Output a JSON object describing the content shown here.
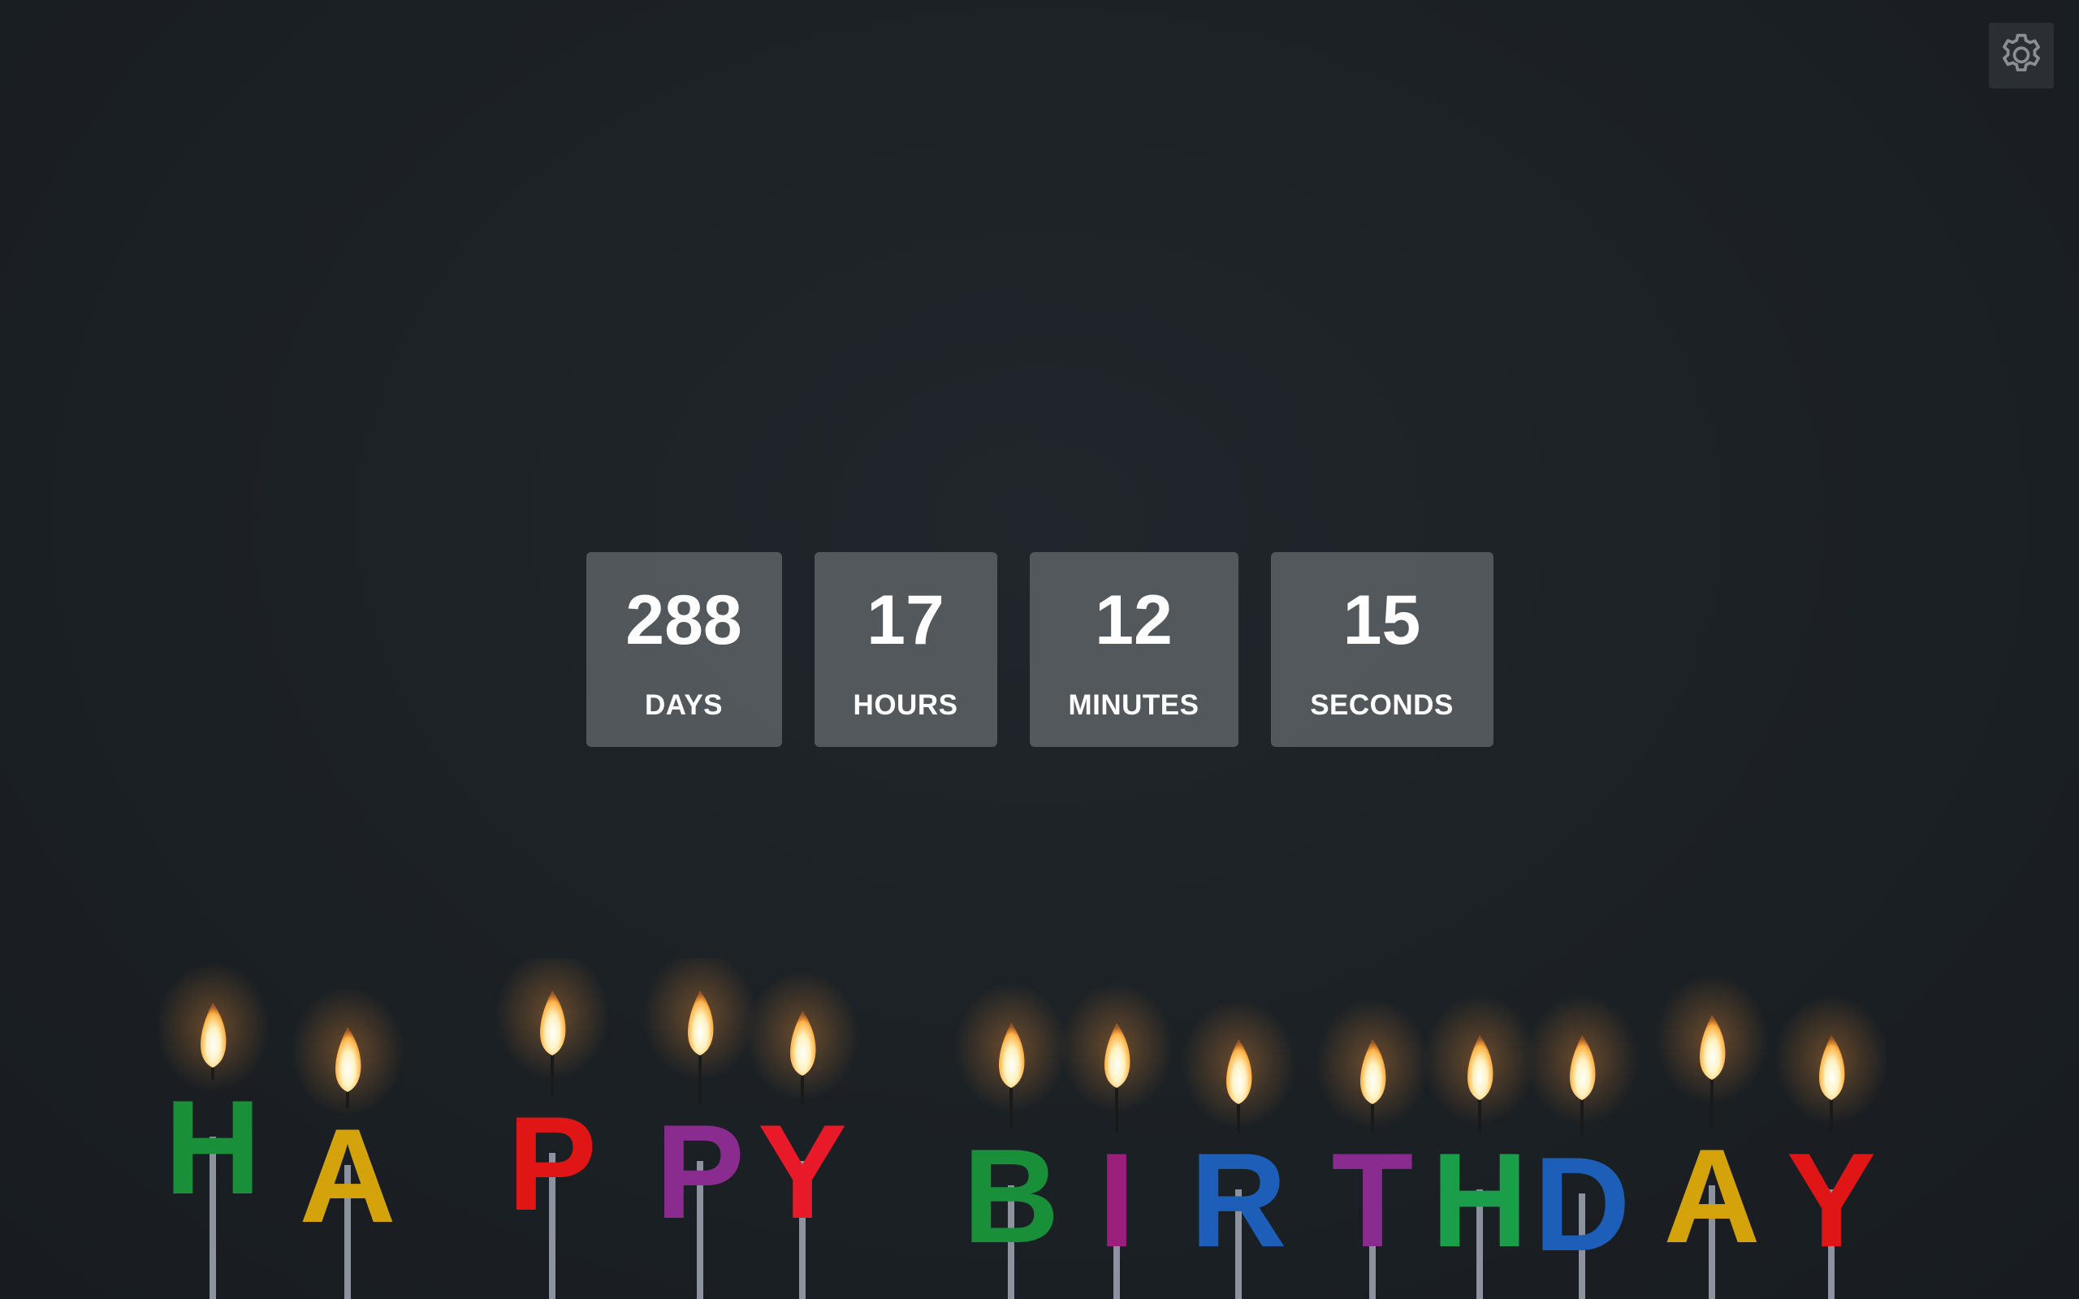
{
  "settings": {
    "icon": "gear-icon"
  },
  "countdown": {
    "days": {
      "value": "288",
      "label": "DAYS"
    },
    "hours": {
      "value": "17",
      "label": "HOURS"
    },
    "minutes": {
      "value": "12",
      "label": "MINUTES"
    },
    "seconds": {
      "value": "15",
      "label": "SECONDS"
    }
  },
  "background": {
    "letters": [
      "H",
      "A",
      "P",
      "P",
      "Y",
      "B",
      "I",
      "R",
      "T",
      "H",
      "D",
      "A",
      "Y"
    ],
    "colors": [
      "#1a8f3a",
      "#d4a20a",
      "#e01616",
      "#8a2b8f",
      "#e81a2a",
      "#1a8f3a",
      "#9b1f7a",
      "#1d5fb8",
      "#8a2b8f",
      "#1a9e4a",
      "#1d5fb8",
      "#d4a20a",
      "#e01616"
    ]
  }
}
